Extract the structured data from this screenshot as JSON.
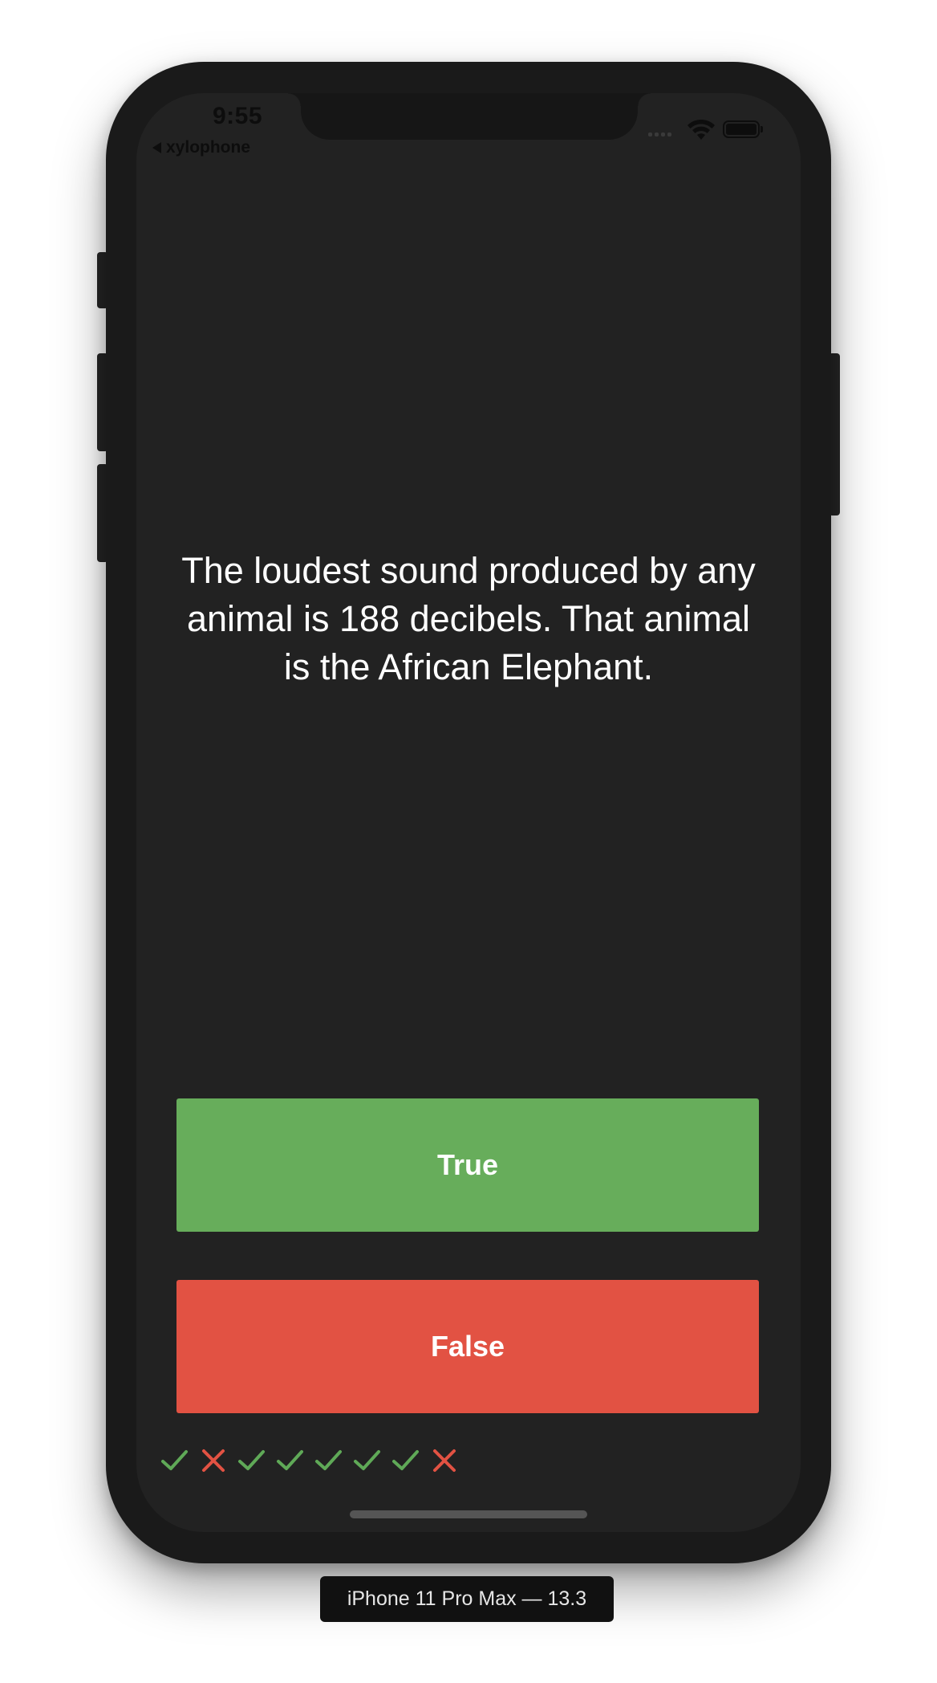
{
  "status_bar": {
    "time": "9:55",
    "back_label": "xylophone",
    "icons": [
      "signal-icon",
      "wifi-icon",
      "battery-icon"
    ]
  },
  "quiz": {
    "question": "The loudest sound produced by any animal is 188 decibels. That animal is the African Elephant.",
    "true_label": "True",
    "false_label": "False",
    "true_color": "#67ad5b",
    "false_color": "#e25243",
    "score": [
      "correct",
      "incorrect",
      "correct",
      "correct",
      "correct",
      "correct",
      "correct",
      "incorrect"
    ]
  },
  "device_label": "iPhone 11 Pro Max — 13.3",
  "colors": {
    "screen_background": "#222222",
    "check": "#5fa957",
    "cross": "#e25243"
  }
}
